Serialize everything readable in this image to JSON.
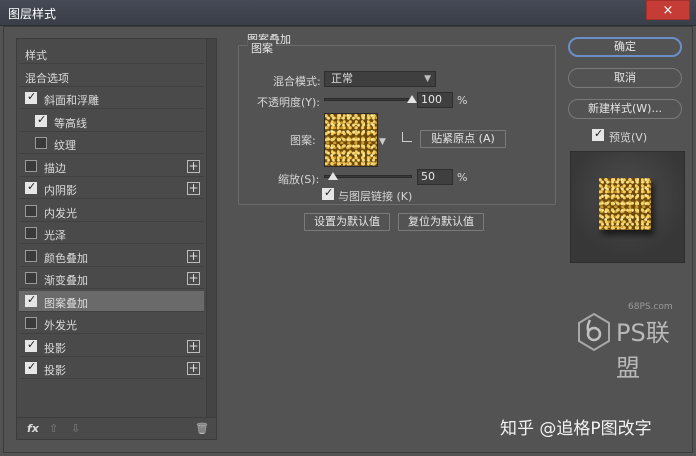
{
  "window": {
    "title": "图层样式",
    "close_symbol": "×"
  },
  "sidebar": {
    "items": [
      {
        "label": "样式",
        "has_checkbox": false,
        "checked": false,
        "has_plus": false,
        "selected": false
      },
      {
        "label": "混合选项",
        "has_checkbox": false,
        "checked": false,
        "has_plus": false,
        "selected": false
      },
      {
        "label": "斜面和浮雕",
        "has_checkbox": true,
        "checked": true,
        "has_plus": false,
        "selected": false
      },
      {
        "label": "等高线",
        "has_checkbox": true,
        "checked": true,
        "has_plus": false,
        "selected": false,
        "indent": true
      },
      {
        "label": "纹理",
        "has_checkbox": true,
        "checked": false,
        "has_plus": false,
        "selected": false,
        "indent": true
      },
      {
        "label": "描边",
        "has_checkbox": true,
        "checked": false,
        "has_plus": true,
        "selected": false
      },
      {
        "label": "内阴影",
        "has_checkbox": true,
        "checked": true,
        "has_plus": true,
        "selected": false
      },
      {
        "label": "内发光",
        "has_checkbox": true,
        "checked": false,
        "has_plus": false,
        "selected": false
      },
      {
        "label": "光泽",
        "has_checkbox": true,
        "checked": false,
        "has_plus": false,
        "selected": false
      },
      {
        "label": "颜色叠加",
        "has_checkbox": true,
        "checked": false,
        "has_plus": true,
        "selected": false
      },
      {
        "label": "渐变叠加",
        "has_checkbox": true,
        "checked": false,
        "has_plus": true,
        "selected": false
      },
      {
        "label": "图案叠加",
        "has_checkbox": true,
        "checked": true,
        "has_plus": false,
        "selected": true
      },
      {
        "label": "外发光",
        "has_checkbox": true,
        "checked": false,
        "has_plus": false,
        "selected": false
      },
      {
        "label": "投影",
        "has_checkbox": true,
        "checked": true,
        "has_plus": true,
        "selected": false
      },
      {
        "label": "投影",
        "has_checkbox": true,
        "checked": true,
        "has_plus": true,
        "selected": false
      }
    ],
    "footer": {
      "fx_label": "fx",
      "up_symbol": "⇧",
      "down_symbol": "⇩",
      "trash_symbol": "🗑"
    }
  },
  "panel": {
    "section_title": "图案叠加",
    "group_title": "图案",
    "blend_mode_label": "混合模式:",
    "blend_mode_value": "正常",
    "opacity_label": "不透明度(Y):",
    "opacity_value": "100",
    "opacity_unit": "%",
    "opacity_fraction": 1.0,
    "pattern_label": "图案:",
    "snap_button": "贴紧原点 (A)",
    "scale_label": "缩放(S):",
    "scale_value": "50",
    "scale_unit": "%",
    "scale_fraction": 0.1,
    "link_label": "与图层链接 (K)",
    "link_checked": true,
    "set_default_button": "设置为默认值",
    "reset_default_button": "复位为默认值"
  },
  "actions": {
    "ok": "确定",
    "cancel": "取消",
    "new_style": "新建样式(W)...",
    "preview_label": "预览(V)",
    "preview_checked": true
  },
  "watermarks": {
    "site": "68PS.com",
    "brand": "PS联盟",
    "credit": "知乎 @追格P图改字"
  }
}
